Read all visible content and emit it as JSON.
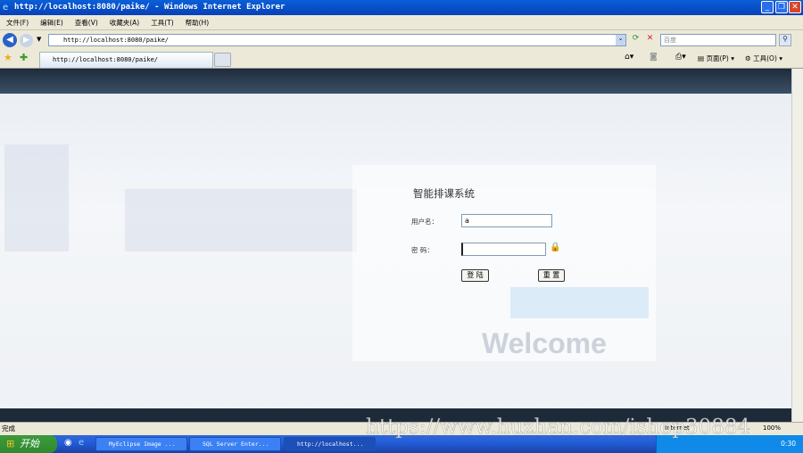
{
  "window": {
    "title": "http://localhost:8080/paike/ - Windows Internet Explorer"
  },
  "menu": [
    "文件(F)",
    "编辑(E)",
    "查看(V)",
    "收藏夹(A)",
    "工具(T)",
    "帮助(H)"
  ],
  "address": {
    "url": "http://localhost:8080/paike/"
  },
  "search": {
    "placeholder": "百度"
  },
  "tab": {
    "label": "http://localhost:8080/paike/"
  },
  "commandbar": {
    "page": "页面(P)",
    "tools": "工具(O)"
  },
  "login": {
    "title": "智能排课系统",
    "username_label": "用户名：",
    "username_value": "a",
    "password_label": "密 码：",
    "password_value": "",
    "login_button": "登 陆",
    "reset_button": "重 置"
  },
  "background": {
    "welcome": "Welcome"
  },
  "status": {
    "text": "完成",
    "zone": "Internet",
    "zoom": "100%"
  },
  "taskbar": {
    "start": "开始",
    "tasks": [
      "MyEclipse Image ...",
      "SQL Server Enter...",
      "http://localhost..."
    ],
    "clock": "0:30"
  },
  "watermark": "https://www.huzhan.com/ishop30884"
}
